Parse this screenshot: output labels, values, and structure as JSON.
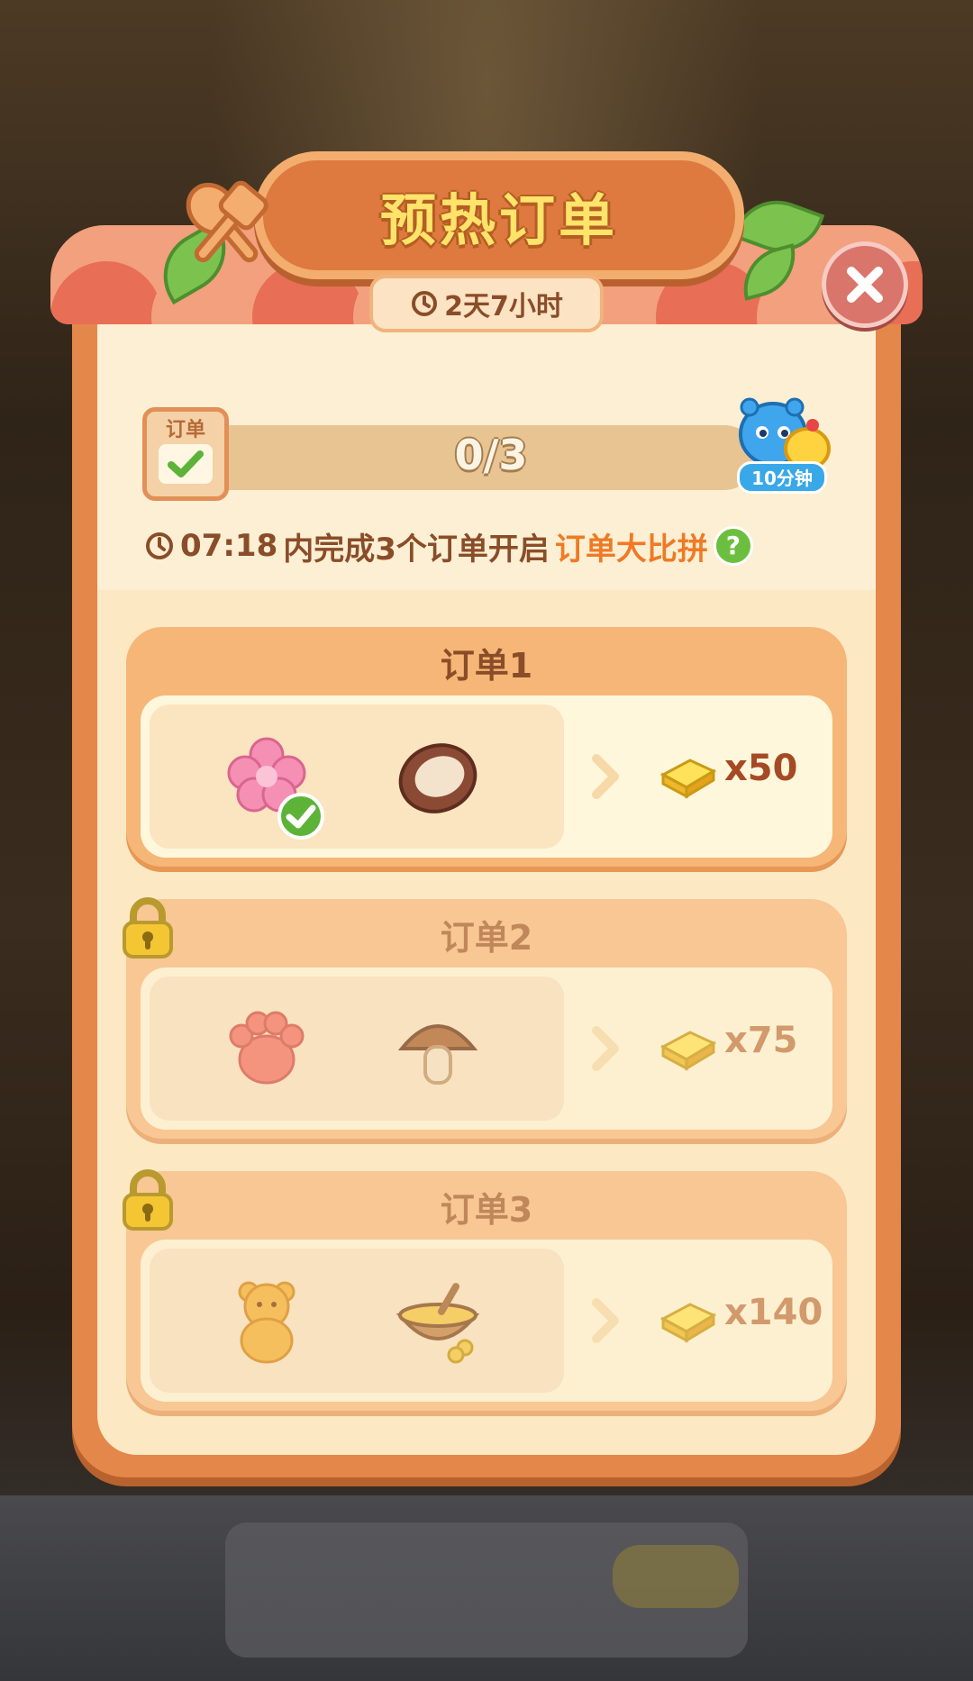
{
  "header": {
    "title": "预热订单",
    "timer": "2天7小时"
  },
  "progress": {
    "badge_label": "订单",
    "value": "0/3",
    "reward_tag": "10分钟"
  },
  "info": {
    "time": "07:18",
    "text": "内完成3个订单开启",
    "accent": "订单大比拼",
    "help": "?"
  },
  "orders": [
    {
      "title": "订单1",
      "reward": "x50",
      "locked": false,
      "items": [
        "pink-flower-candy",
        "coconut"
      ],
      "first_item_done": true
    },
    {
      "title": "订单2",
      "reward": "x75",
      "locked": true,
      "items": [
        "paw-jelly",
        "mushroom"
      ]
    },
    {
      "title": "订单3",
      "reward": "x140",
      "locked": true,
      "items": [
        "gummy-bear",
        "honey-bowl"
      ]
    }
  ],
  "colors": {
    "panel": "#e4874a",
    "accent": "#ef7a25",
    "title": "#ffe36a",
    "text": "#8a4d29"
  }
}
